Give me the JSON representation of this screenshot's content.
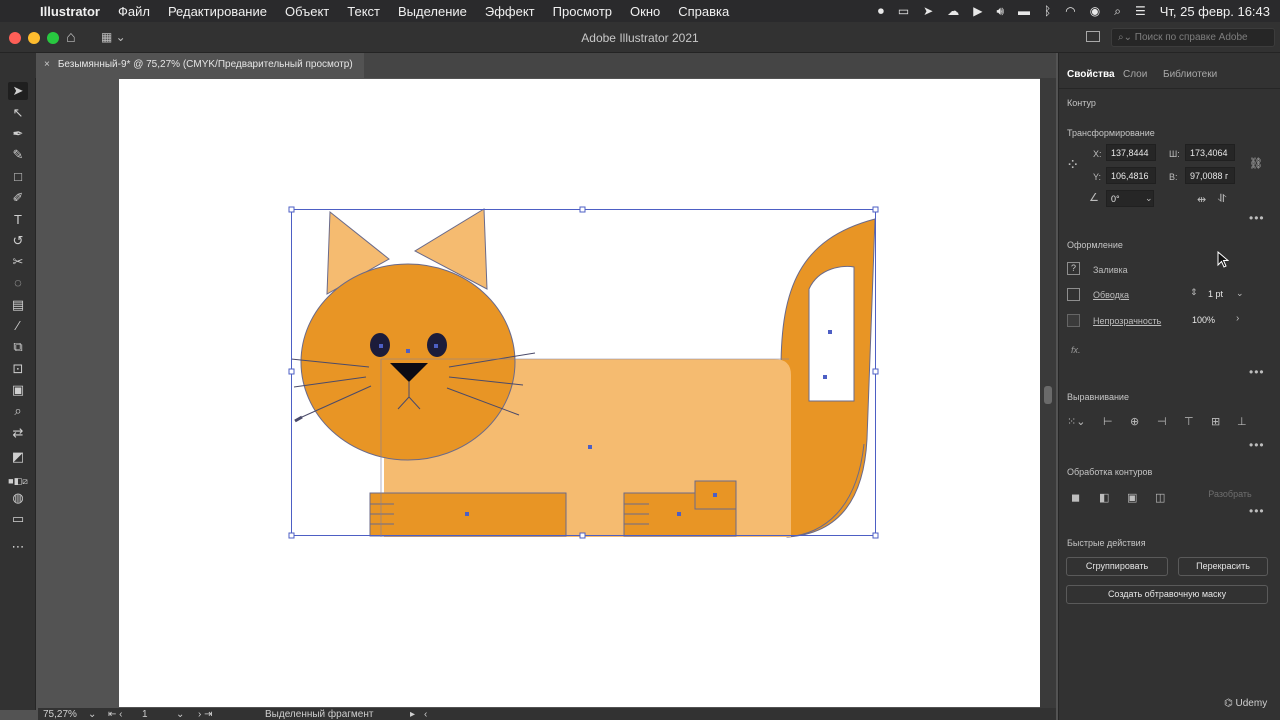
{
  "menubar": {
    "apple_icon": "apple-logo-icon",
    "app_name": "Illustrator",
    "items": [
      "Файл",
      "Редактирование",
      "Объект",
      "Текст",
      "Выделение",
      "Эффект",
      "Просмотр",
      "Окно",
      "Справка"
    ],
    "clock": "Чт, 25 февр.  16:43"
  },
  "titlebar": {
    "title": "Adobe Illustrator 2021",
    "search_placeholder": "Поиск по справке Adobe"
  },
  "document": {
    "tab_label": "Безымянный-9* @ 75,27% (CMYK/Предварительный просмотр)",
    "close": "×"
  },
  "statusbar": {
    "zoom": "75,27%",
    "artboard": "1",
    "info": "Выделенный фрагмент"
  },
  "panel": {
    "tabs": [
      "Свойства",
      "Слои",
      "Библиотеки"
    ],
    "object_type": "Контур",
    "transform": {
      "title": "Трансформирование",
      "x_label": "X:",
      "x": "137,8444",
      "y_label": "Y:",
      "y": "106,4816",
      "w_label": "Ш:",
      "w": "173,4064",
      "h_label": "В:",
      "h": "97,0088 г",
      "angle": "0°"
    },
    "appearance": {
      "title": "Оформление",
      "fill_label": "Заливка",
      "stroke_label": "Обводка",
      "stroke_weight": "1 pt",
      "opacity_label": "Непрозрачность",
      "opacity": "100%",
      "fx": "fx."
    },
    "align": {
      "title": "Выравнивание"
    },
    "pathfinder": {
      "title": "Обработка контуров",
      "expand": "Разобрать"
    },
    "quick_actions": {
      "title": "Быстрые действия",
      "group": "Сгруппировать",
      "recolor": "Перекрасить",
      "clip_mask": "Создать обтравочную маску"
    }
  },
  "watermark": "Udemy",
  "colors": {
    "cat_light": "#f5bb70",
    "cat_dark": "#e89525",
    "selection": "#4d5fc4"
  }
}
